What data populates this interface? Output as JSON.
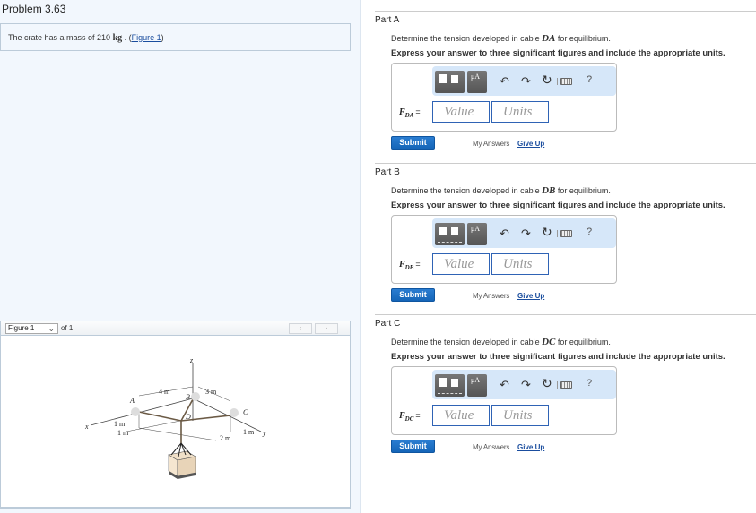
{
  "problem": {
    "title": "Problem 3.63",
    "statement_prefix": "The crate has a mass of 210 ",
    "mass_unit": "kg",
    "statement_suffix": " . (",
    "figure_link": "Figure 1",
    "statement_close": ")"
  },
  "figure_viewer": {
    "selected": "Figure 1",
    "of_label": "of 1",
    "prev_icon": "‹",
    "next_icon": "›",
    "labels": {
      "z": "z",
      "x": "x",
      "y": "y",
      "A": "A",
      "B": "B",
      "C": "C",
      "D": "D",
      "d_4m": "4 m",
      "d_3m": "3 m",
      "d_1m_a": "1 m",
      "d_1m_b": "1 m",
      "d_2m": "2 m",
      "d_1m_c": "1 m"
    }
  },
  "parts": [
    {
      "title": "Part A",
      "question_prefix": "Determine the tension developed in cable ",
      "cable": "DA",
      "question_suffix": " for equilibrium.",
      "instruction": "Express your answer to three significant figures and include the appropriate units.",
      "var_main": "F",
      "var_sub": "DA",
      "equals": "=",
      "value_placeholder": "Value",
      "units_placeholder": "Units",
      "submit": "Submit",
      "my_answers": "My Answers",
      "give_up": "Give Up"
    },
    {
      "title": "Part B",
      "question_prefix": "Determine the tension developed in cable ",
      "cable": "DB",
      "question_suffix": " for equilibrium.",
      "instruction": "Express your answer to three significant figures and include the appropriate units.",
      "var_main": "F",
      "var_sub": "DB",
      "equals": "=",
      "value_placeholder": "Value",
      "units_placeholder": "Units",
      "submit": "Submit",
      "my_answers": "My Answers",
      "give_up": "Give Up"
    },
    {
      "title": "Part C",
      "question_prefix": "Determine the tension developed in cable ",
      "cable": "DC",
      "question_suffix": " for equilibrium.",
      "instruction": "Express your answer to three significant figures and include the appropriate units.",
      "var_main": "F",
      "var_sub": "DC",
      "equals": "=",
      "value_placeholder": "Value",
      "units_placeholder": "Units",
      "submit": "Submit",
      "my_answers": "My Answers",
      "give_up": "Give Up"
    }
  ],
  "toolbar": {
    "templates_icon": "templates-icon",
    "symbols_label": "μA",
    "undo_icon": "↶",
    "redo_icon": "↷",
    "reset_icon": "↻",
    "help_icon": "?"
  },
  "colors": {
    "accent": "#1565b8",
    "link": "#1a4d9e",
    "toolbar_bg": "#d6e7f9",
    "left_bg": "#f2f7fd"
  }
}
